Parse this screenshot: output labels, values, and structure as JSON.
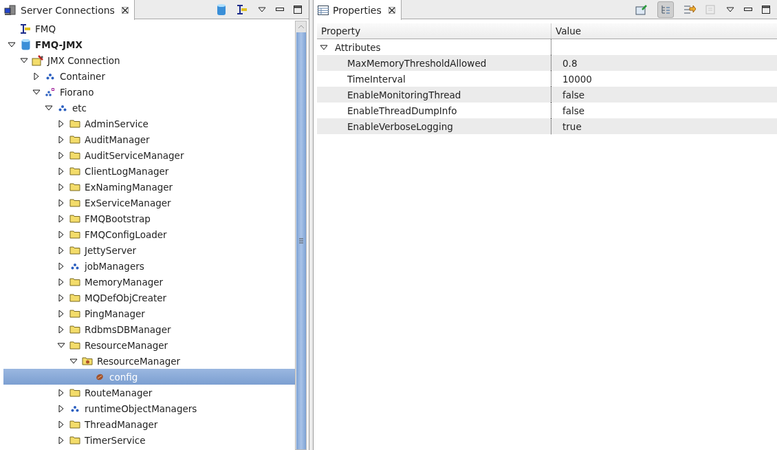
{
  "left_view": {
    "title": "Server Connections",
    "selected": true
  },
  "tree": [
    {
      "label": "FMQ",
      "kind": "server",
      "active": false,
      "selected": false
    },
    {
      "label": "FMQ-JMX",
      "kind": "database",
      "active": true,
      "selected": false,
      "expanded": true,
      "children": [
        {
          "label": "JMX Connection",
          "kind": "toolbox",
          "selected": false,
          "expanded": true,
          "children": [
            {
              "label": "Container",
              "kind": "cluster",
              "selected": false,
              "expanded": false
            },
            {
              "label": "Fiorano",
              "kind": "linked-cluster",
              "selected": false,
              "expanded": true,
              "children": [
                {
                  "label": "etc",
                  "kind": "cluster",
                  "selected": false,
                  "expanded": true,
                  "children": [
                    {
                      "label": "AdminService",
                      "kind": "folder",
                      "selected": false,
                      "expanded": false
                    },
                    {
                      "label": "AuditManager",
                      "kind": "folder",
                      "selected": false,
                      "expanded": false
                    },
                    {
                      "label": "AuditServiceManager",
                      "kind": "folder",
                      "selected": false,
                      "expanded": false
                    },
                    {
                      "label": "ClientLogManager",
                      "kind": "folder",
                      "selected": false,
                      "expanded": false
                    },
                    {
                      "label": "ExNamingManager",
                      "kind": "folder",
                      "selected": false,
                      "expanded": false
                    },
                    {
                      "label": "ExServiceManager",
                      "kind": "folder",
                      "selected": false,
                      "expanded": false
                    },
                    {
                      "label": "FMQBootstrap",
                      "kind": "folder",
                      "selected": false,
                      "expanded": false
                    },
                    {
                      "label": "FMQConfigLoader",
                      "kind": "folder",
                      "selected": false,
                      "expanded": false
                    },
                    {
                      "label": "JettyServer",
                      "kind": "folder",
                      "selected": false,
                      "expanded": false
                    },
                    {
                      "label": "jobManagers",
                      "kind": "cluster",
                      "selected": false,
                      "expanded": false
                    },
                    {
                      "label": "MemoryManager",
                      "kind": "folder",
                      "selected": false,
                      "expanded": false
                    },
                    {
                      "label": "MQDefObjCreater",
                      "kind": "folder",
                      "selected": false,
                      "expanded": false
                    },
                    {
                      "label": "PingManager",
                      "kind": "folder",
                      "selected": false,
                      "expanded": false
                    },
                    {
                      "label": "RdbmsDBManager",
                      "kind": "folder",
                      "selected": false,
                      "expanded": false
                    },
                    {
                      "label": "ResourceManager",
                      "kind": "folder",
                      "selected": false,
                      "expanded": true,
                      "children": [
                        {
                          "label": "ResourceManager",
                          "kind": "bean-folder",
                          "selected": false,
                          "expanded": true,
                          "children": [
                            {
                              "label": "config",
                              "kind": "bean",
                              "selected": true
                            }
                          ]
                        }
                      ]
                    },
                    {
                      "label": "RouteManager",
                      "kind": "folder",
                      "selected": false,
                      "expanded": false
                    },
                    {
                      "label": "runtimeObjectManagers",
                      "kind": "cluster",
                      "selected": false,
                      "expanded": false
                    },
                    {
                      "label": "ThreadManager",
                      "kind": "folder",
                      "selected": false,
                      "expanded": false
                    },
                    {
                      "label": "TimerService",
                      "kind": "folder",
                      "selected": false,
                      "expanded": false
                    }
                  ]
                }
              ]
            }
          ]
        }
      ]
    }
  ],
  "right_view": {
    "title": "Properties",
    "selected": true
  },
  "properties": {
    "columns": [
      "Property",
      "Value"
    ],
    "group": {
      "label": "Attributes",
      "expanded": true
    },
    "rows": [
      {
        "property": "MaxMemoryThresholdAllowed",
        "value": "0.8"
      },
      {
        "property": "TimeInterval",
        "value": "10000"
      },
      {
        "property": "EnableMonitoringThread",
        "value": "false"
      },
      {
        "property": "EnableThreadDumpInfo",
        "value": "false"
      },
      {
        "property": "EnableVerboseLogging",
        "value": "true"
      }
    ]
  }
}
